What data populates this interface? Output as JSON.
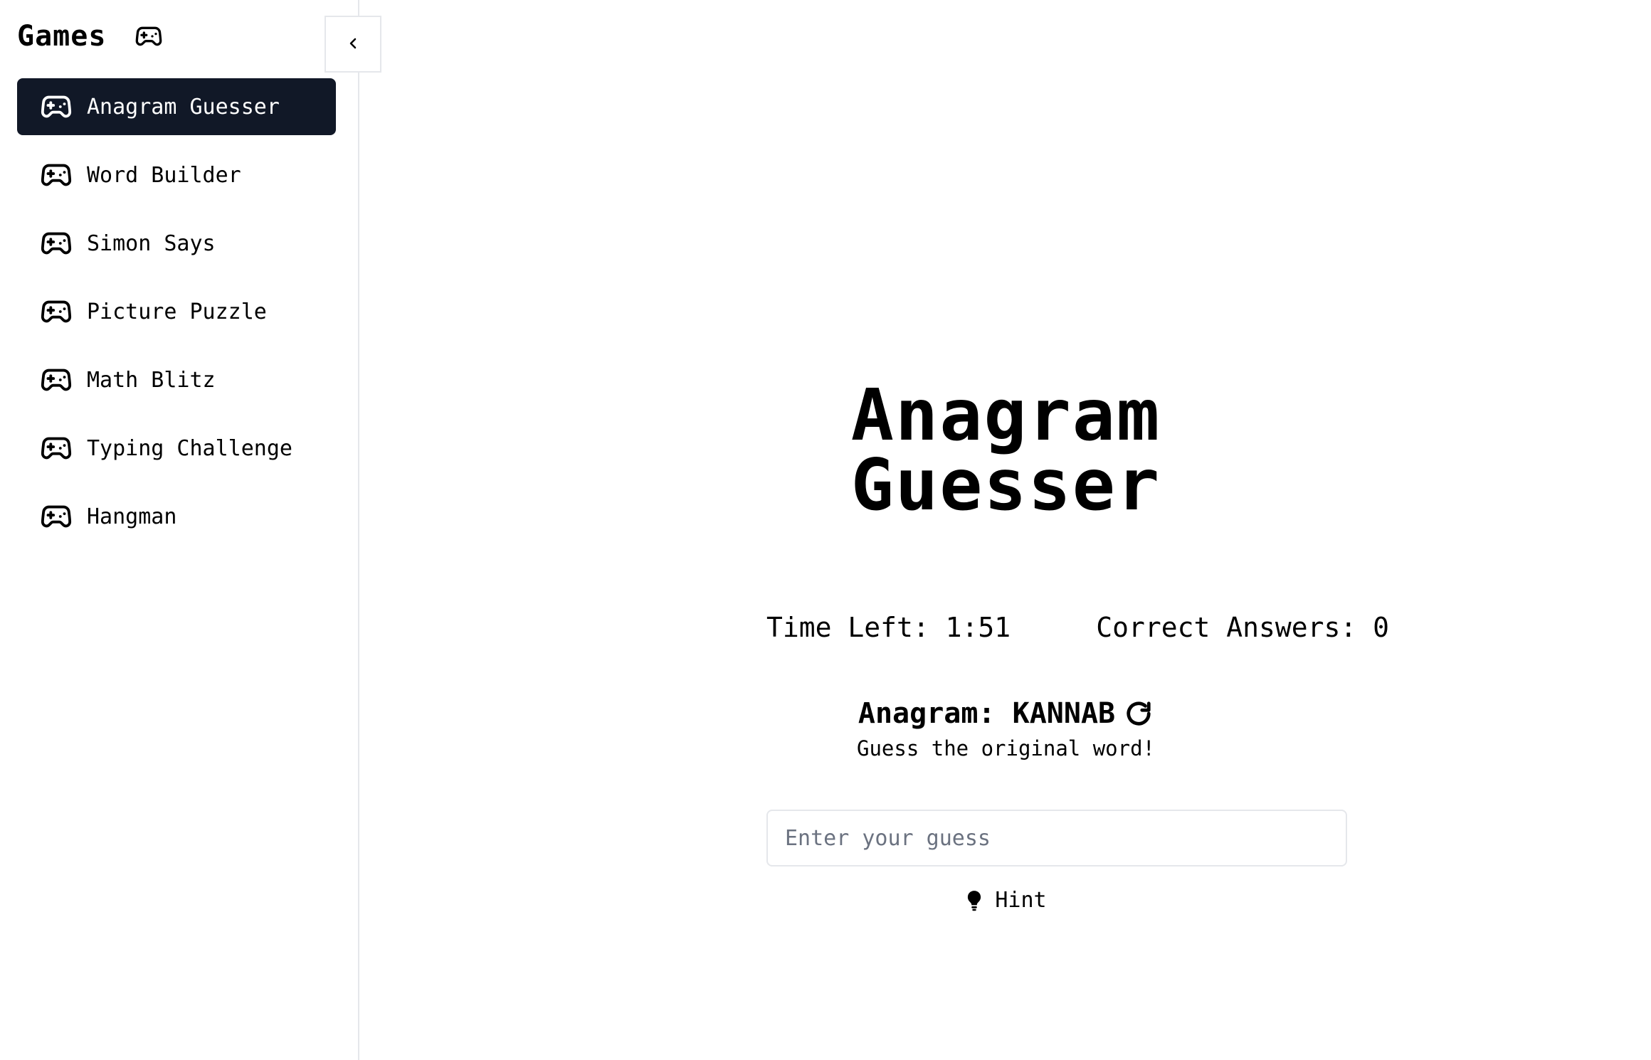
{
  "sidebar": {
    "title": "Games",
    "title_icon": "gamepad-icon",
    "collapse_icon": "chevron-left-icon",
    "items": [
      {
        "label": "Anagram Guesser",
        "icon": "gamepad-icon",
        "active": true
      },
      {
        "label": "Word Builder",
        "icon": "gamepad-icon",
        "active": false
      },
      {
        "label": "Simon Says",
        "icon": "gamepad-icon",
        "active": false
      },
      {
        "label": "Picture Puzzle",
        "icon": "gamepad-icon",
        "active": false
      },
      {
        "label": "Math Blitz",
        "icon": "gamepad-icon",
        "active": false
      },
      {
        "label": "Typing Challenge",
        "icon": "gamepad-icon",
        "active": false
      },
      {
        "label": "Hangman",
        "icon": "gamepad-icon",
        "active": false
      }
    ]
  },
  "game": {
    "title_line1": "Anagram",
    "title_line2": "Guesser",
    "time_label": "Time Left:",
    "time_value": "1:51",
    "correct_label": "Correct Answers:",
    "correct_value": "0",
    "anagram_label": "Anagram:",
    "anagram_word": "KANNAB",
    "refresh_icon": "refresh-icon",
    "instruction": "Guess the original word!",
    "guess_placeholder": "Enter your guess",
    "guess_value": "",
    "hint_label": "Hint",
    "hint_icon": "lightbulb-icon"
  },
  "colors": {
    "active_bg": "#111827",
    "border": "#e5e7eb",
    "placeholder": "#6b7280"
  }
}
